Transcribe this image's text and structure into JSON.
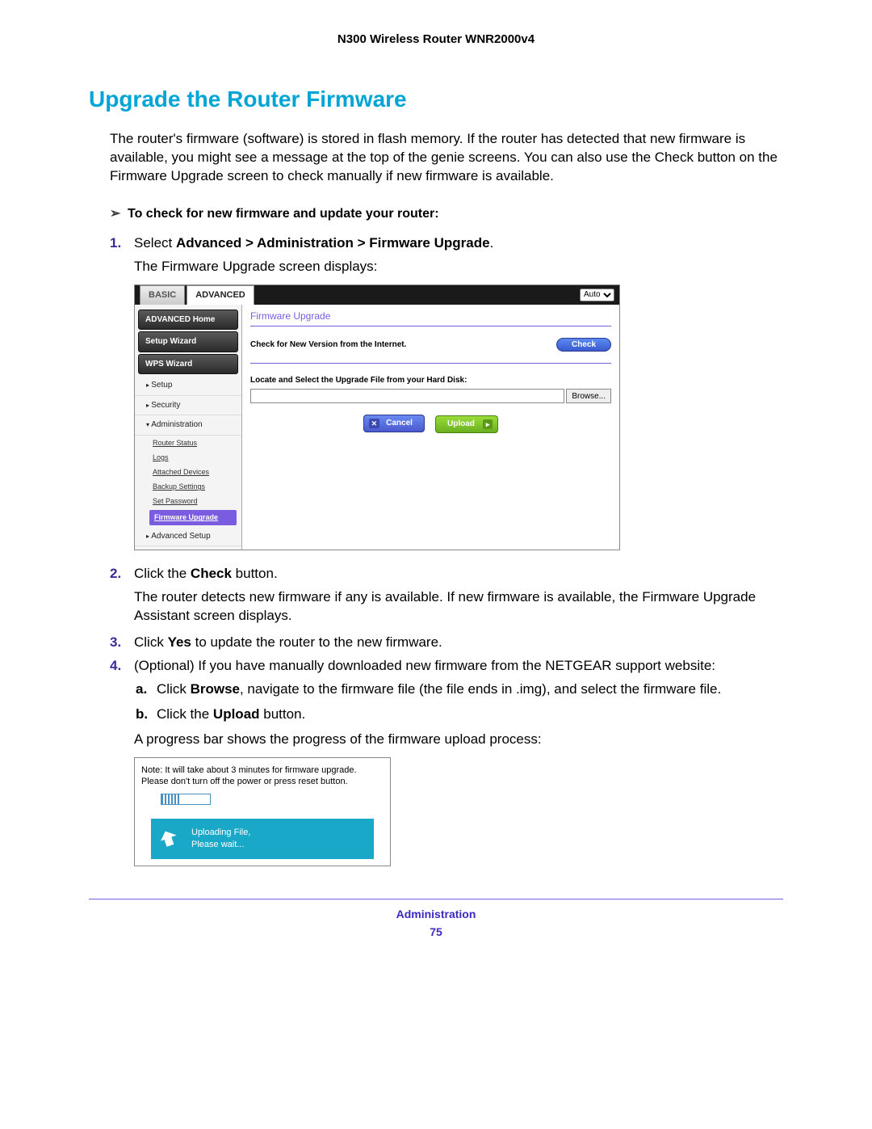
{
  "header": {
    "product": "N300 Wireless Router WNR2000v4"
  },
  "title": "Upgrade the Router Firmware",
  "intro": "The router's firmware (software) is stored in flash memory. If the router has detected that new firmware is available, you might see a message at the top of the genie screens. You can also use the Check button on the Firmware Upgrade screen to check manually if new firmware is available.",
  "procedure_header": "To check for new firmware and update your router:",
  "steps": {
    "s1a": "Select ",
    "s1b": "Advanced > Administration > Firmware Upgrade",
    "s1c": ".",
    "s1_sub": "The Firmware Upgrade screen displays:",
    "s2a": "Click the ",
    "s2b": "Check",
    "s2c": " button.",
    "s2_sub": "The router detects new firmware if any is available. If new firmware is available, the Firmware Upgrade Assistant screen displays.",
    "s3a": "Click ",
    "s3b": "Yes",
    "s3c": " to update the router to the new firmware.",
    "s4": "(Optional) If you have manually downloaded new firmware from the NETGEAR support website:",
    "s4a_a": "Click ",
    "s4a_b": "Browse",
    "s4a_c": ", navigate to the firmware file (the file ends in .img), and select the firmware file.",
    "s4b_a": "Click the ",
    "s4b_b": "Upload",
    "s4b_c": " button.",
    "s4_sub": "A progress bar shows the progress of the firmware upload process:"
  },
  "screenshot1": {
    "tabs": {
      "basic": "BASIC",
      "advanced": "ADVANCED"
    },
    "lang": "Auto",
    "sidebar": {
      "home": "ADVANCED Home",
      "setup_wizard": "Setup Wizard",
      "wps_wizard": "WPS Wizard",
      "setup": "Setup",
      "security": "Security",
      "administration": "Administration",
      "subs": {
        "router_status": "Router Status",
        "logs": "Logs",
        "attached": "Attached Devices",
        "backup": "Backup Settings",
        "setpw": "Set Password",
        "fw": "Firmware Upgrade"
      },
      "advanced_setup": "Advanced Setup"
    },
    "main": {
      "title": "Firmware Upgrade",
      "check_label": "Check for New Version from the Internet.",
      "check_btn": "Check",
      "locate_label": "Locate and Select the Upgrade File from your Hard Disk:",
      "browse_btn": "Browse...",
      "cancel_btn": "Cancel",
      "upload_btn": "Upload"
    }
  },
  "screenshot2": {
    "note": "Note: It will take about 3 minutes for firmware upgrade. Please don't turn off the power or press reset button.",
    "banner_line1": "Uploading File,",
    "banner_line2": "Please wait..."
  },
  "footer": {
    "section": "Administration",
    "page": "75"
  }
}
